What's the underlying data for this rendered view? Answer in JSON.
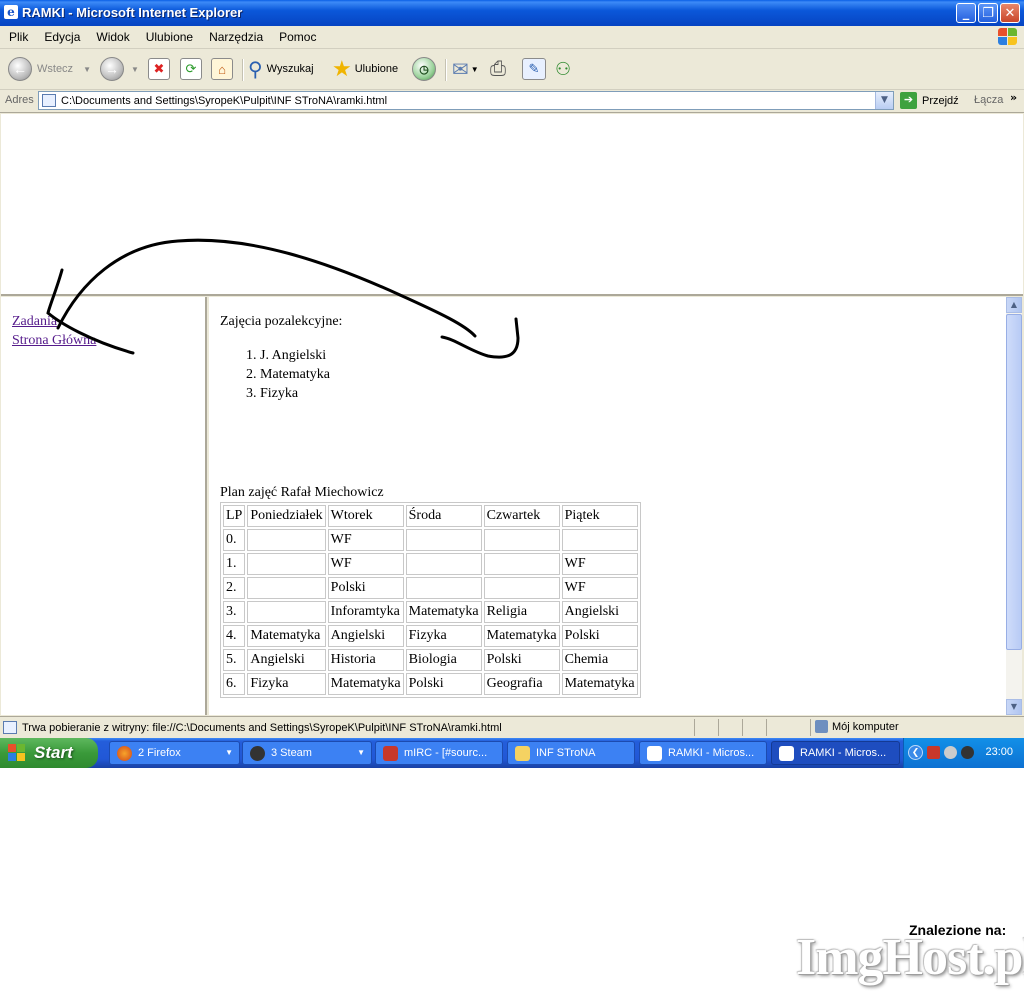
{
  "window": {
    "title": "RAMKI - Microsoft Internet Explorer"
  },
  "menu": [
    "Plik",
    "Edycja",
    "Widok",
    "Ulubione",
    "Narzędzia",
    "Pomoc"
  ],
  "toolbar": {
    "back_label": "Wstecz",
    "search_label": "Wyszukaj",
    "favorites_label": "Ulubione"
  },
  "address": {
    "label": "Adres",
    "value": "C:\\Documents and Settings\\SyropeK\\Pulpit\\INF STroNA\\ramki.html",
    "go_label": "Przejdź",
    "links_label": "Łącza",
    "more": "»"
  },
  "left_frame": {
    "links": [
      "Zadania",
      "Strona Główna"
    ]
  },
  "main_frame": {
    "heading": "Zajęcia pozalekcyjne:",
    "list": [
      "J. Angielski",
      "Matematyka",
      "Fizyka"
    ],
    "plan_title": "Plan zajęć Rafał Miechowicz",
    "table": {
      "headers": [
        "LP",
        "Poniedziałek",
        "Wtorek",
        "Środa",
        "Czwartek",
        "Piątek"
      ],
      "rows": [
        [
          "0.",
          "",
          "WF",
          "",
          "",
          ""
        ],
        [
          "1.",
          "",
          "WF",
          "",
          "",
          "WF"
        ],
        [
          "2.",
          "",
          "Polski",
          "",
          "",
          "WF"
        ],
        [
          "3.",
          "",
          "Inforamtyka",
          "Matematyka",
          "Religia",
          "Angielski"
        ],
        [
          "4.",
          "Matematyka",
          "Angielski",
          "Fizyka",
          "Matematyka",
          "Polski"
        ],
        [
          "5.",
          "Angielski",
          "Historia",
          "Biologia",
          "Polski",
          "Chemia"
        ],
        [
          "6.",
          "Fizyka",
          "Matematyka",
          "Polski",
          "Geografia",
          "Matematyka"
        ]
      ]
    }
  },
  "status": {
    "text": "Trwa pobieranie z witryny: file://C:\\Documents and Settings\\SyropeK\\Pulpit\\INF STroNA\\ramki.html",
    "zone": "Mój komputer"
  },
  "taskbar": {
    "start_label": "Start",
    "tasks": [
      "2 Firefox",
      "3 Steam",
      "mIRC - [#sourc...",
      "INF STroNA",
      "RAMKI - Micros...",
      "RAMKI - Micros..."
    ],
    "clock": "23:00"
  },
  "watermark": {
    "found_on": "Znalezione na:",
    "brand": "ImgHost.pl"
  },
  "colors": {
    "visited_link": "#551a8b",
    "titlebar": "#0b58da",
    "annotation": "#000000"
  }
}
